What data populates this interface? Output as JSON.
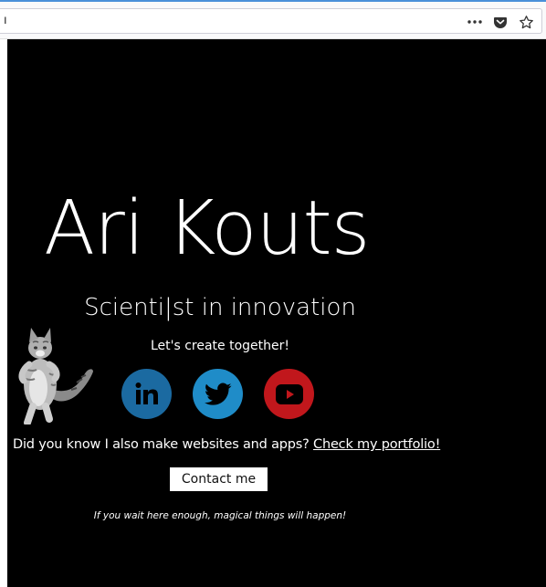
{
  "browser": {
    "url_text": "ı",
    "actions": [
      "more-icon",
      "pocket-icon",
      "bookmark-star-icon"
    ]
  },
  "hero": {
    "name": "Ari Kouts",
    "subtitle": "Scienti|st in innovation",
    "tagline": "Let's create together!"
  },
  "social": [
    {
      "name": "linkedin",
      "label": "in",
      "color": "#1b6aa1"
    },
    {
      "name": "twitter",
      "label": "",
      "color": "#1f8cc8"
    },
    {
      "name": "youtube",
      "label": "",
      "color": "#c1171c"
    }
  ],
  "portfolio": {
    "text": "Did you know I also make websites and apps? ",
    "link_text": "Check my portfolio!"
  },
  "contact": {
    "button_label": "Contact me"
  },
  "footer_note": "If you wait here enough, magical things will happen!",
  "colors": {
    "background": "#000000",
    "text": "#ffffff"
  }
}
